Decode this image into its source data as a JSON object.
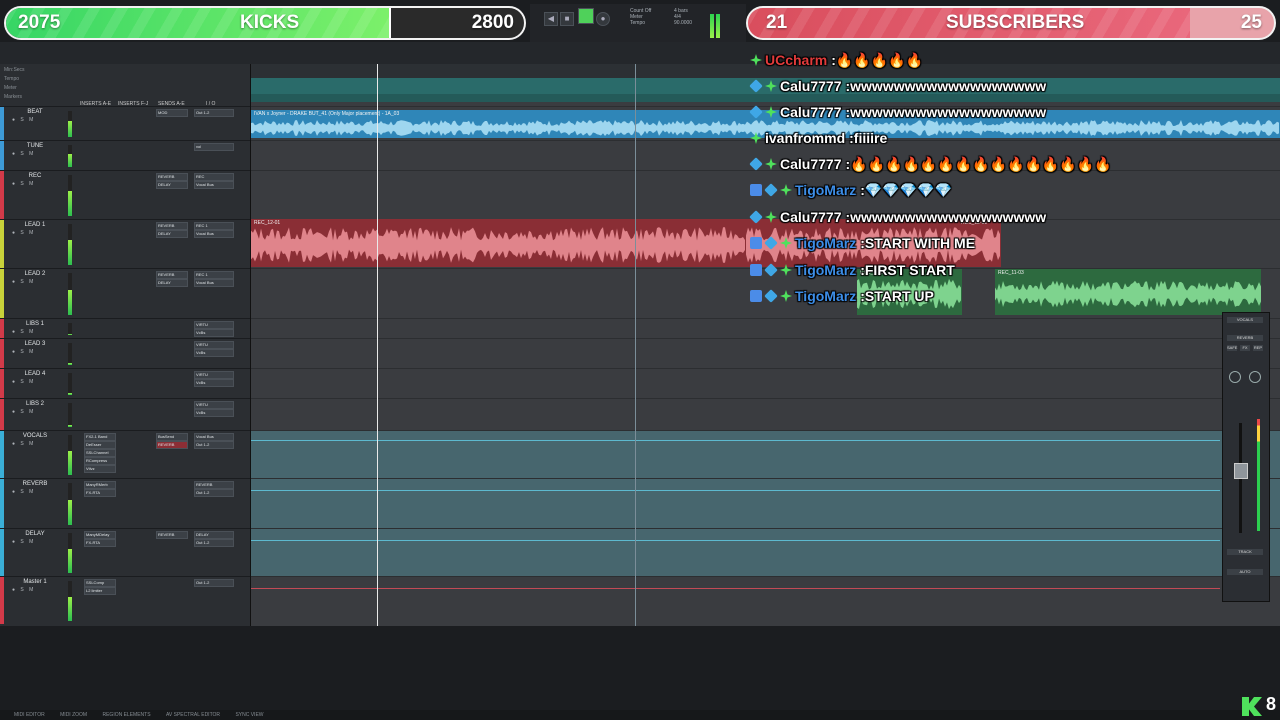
{
  "goals": {
    "kicks": {
      "count": "2075",
      "label": "KICKS",
      "target": "2800",
      "progress": 0.74
    },
    "subscribers": {
      "count": "21",
      "label": "SUBSCRIBERS",
      "target": "25",
      "progress": 0.84
    }
  },
  "colors": {
    "kicks_fill": "#4fe15c",
    "subs_fill": "#d94e5d",
    "timeline_bg": "#3a3c40",
    "playhead": "#e9e9e9"
  },
  "ruler_labels": [
    "Min:Secs",
    "Tempo",
    "Meter",
    "Markers"
  ],
  "tracks_header": {
    "inserts_a": "INSERTS A-E",
    "inserts_f": "INSERTS F-J",
    "sends": "SENDS A-E",
    "io": "I / O"
  },
  "tracks": [
    {
      "name": "BEAT",
      "color": "#3d9ad6",
      "inserts": [],
      "sends": [
        "MOD"
      ],
      "io": [
        "Out 1-2"
      ]
    },
    {
      "name": "TUNE",
      "color": "#3d9ad6",
      "inserts": [],
      "sends": [],
      "io": [
        "vol"
      ]
    },
    {
      "name": "REC",
      "color": "#d23a49",
      "inserts": [],
      "sends": [
        "REVERB",
        "DELAY"
      ],
      "io": [
        "REC",
        "Vocal Bus"
      ]
    },
    {
      "name": "LEAD 1",
      "color": "#c8d23a",
      "inserts": [],
      "sends": [
        "REVERB",
        "DELAY"
      ],
      "io": [
        "REC 1",
        "Vocal Bus"
      ]
    },
    {
      "name": "LEAD 2",
      "color": "#c8d23a",
      "inserts": [],
      "sends": [
        "REVERB",
        "DELAY"
      ],
      "io": [
        "REC 1",
        "Vocal Bus"
      ]
    },
    {
      "name": "LIBS 1",
      "color": "#d23a49",
      "inserts": [],
      "sends": [],
      "io": [
        "VIRTU",
        "VcBs"
      ]
    },
    {
      "name": "LEAD 3",
      "color": "#d23a49",
      "inserts": [],
      "sends": [],
      "io": [
        "VIRTU",
        "VcBs"
      ]
    },
    {
      "name": "LEAD 4",
      "color": "#d23a49",
      "inserts": [],
      "sends": [],
      "io": [
        "VIRTU",
        "VcBs"
      ]
    },
    {
      "name": "LIBS 2",
      "color": "#d23a49",
      "inserts": [],
      "sends": [],
      "io": [
        "VIRTU",
        "VcBs"
      ]
    },
    {
      "name": "VOCALS",
      "color": "#3aaed6",
      "inserts": [
        "FX2-1 Band",
        "DeEsser",
        "SSLChannel",
        "RCompress",
        "Vtlvz"
      ],
      "sends": [
        "BusSend",
        "REVERB"
      ],
      "io": [
        "Vocal Bus",
        "Out 1-2"
      ]
    },
    {
      "name": "REVERB",
      "color": "#3aaed6",
      "inserts": [
        "ManyRMerb",
        "FX-RTA"
      ],
      "sends": [],
      "io": [
        "REVERB",
        "Out 1-2"
      ]
    },
    {
      "name": "DELAY",
      "color": "#3aaed6",
      "inserts": [
        "ManyMDelay",
        "FX-RTA"
      ],
      "sends": [
        "REVERB"
      ],
      "io": [
        "DELAY",
        "Out 1-2"
      ]
    },
    {
      "name": "Master 1",
      "color": "#d23a49",
      "inserts": [
        "SSLComp",
        "L2 limiter"
      ],
      "sends": [],
      "io": [
        "Out 1-2"
      ]
    }
  ],
  "clips": {
    "beat": "IVAN x Joyner - DRAKE BUT_41 (Only Major placement) - 1A_03",
    "rec1": "REC_12-01",
    "rec2": "REC_12-01",
    "rec3": "REC_11-03",
    "rec4": "REC_11-03"
  },
  "chat": [
    {
      "user": "UCcharm",
      "text": "🔥🔥🔥🔥🔥",
      "user_color": "#e23b3b",
      "badges": [
        "green"
      ]
    },
    {
      "user": "Calu7777",
      "text": "wwwwwwwwwwwwwwwwww",
      "user_color": "#ffffff",
      "badges": [
        "blue",
        "green"
      ]
    },
    {
      "user": "Calu7777",
      "text": "wwwwwwwwwwwwwwwwww",
      "user_color": "#ffffff",
      "badges": [
        "blue",
        "green"
      ]
    },
    {
      "user": "ivanfrommd",
      "text": "fiiiire",
      "user_color": "#ffffff",
      "badges": [
        "green"
      ]
    },
    {
      "user": "Calu7777",
      "text": "🔥🔥🔥🔥🔥🔥🔥🔥🔥🔥🔥🔥🔥🔥🔥",
      "user_color": "#ffffff",
      "badges": [
        "blue",
        "green"
      ]
    },
    {
      "user": "TigoMarz",
      "text": "💎💎💎💎💎",
      "user_color": "#3d8ee8",
      "badges": [
        "sq",
        "blue",
        "green"
      ]
    },
    {
      "user": "Calu7777",
      "text": "wwwwwwwwwwwwwwwwww",
      "user_color": "#ffffff",
      "badges": [
        "blue",
        "green"
      ]
    },
    {
      "user": "TigoMarz",
      "text": "START WITH ME",
      "user_color": "#3d8ee8",
      "badges": [
        "sq",
        "blue",
        "green"
      ]
    },
    {
      "user": "TigoMarz",
      "text": "FIRST START",
      "user_color": "#3d8ee8",
      "badges": [
        "sq",
        "blue",
        "green"
      ]
    },
    {
      "user": "TigoMarz",
      "text": "START UP",
      "user_color": "#3d8ee8",
      "badges": [
        "sq",
        "blue",
        "green"
      ]
    }
  ],
  "mixer": {
    "track": "VOCALS",
    "send": "REVERB",
    "buttons": [
      "SAFE",
      "FX",
      "REP"
    ],
    "footer": "TRACK",
    "auto": "AUTO"
  },
  "bottom_tabs": [
    "MIDI EDITOR",
    "MIDI ZOOM",
    "REGION ELEMENTS",
    "AV SPECTRAL EDITOR",
    "SYNC VIEW"
  ],
  "kick_viewers": "8"
}
